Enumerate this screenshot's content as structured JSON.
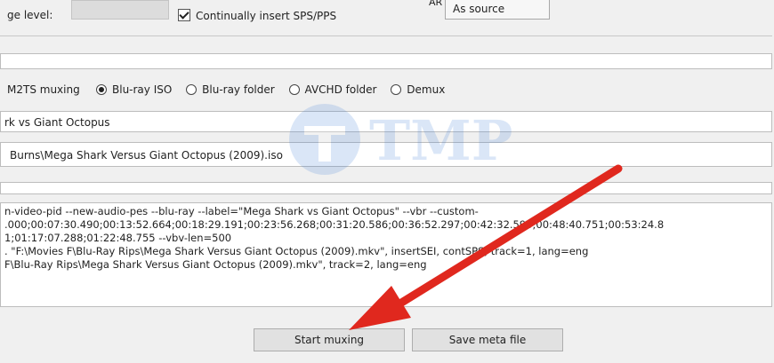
{
  "top": {
    "level_label": "ge level:",
    "sps_checkbox_label": "Continually insert SPS/PPS",
    "sps_checked": true,
    "ar_label": "AR",
    "ar_value": "As source"
  },
  "mux": {
    "label": "M2TS muxing",
    "options": [
      {
        "label": "Blu-ray ISO",
        "selected": true
      },
      {
        "label": "Blu-ray folder",
        "selected": false
      },
      {
        "label": "AVCHD folder",
        "selected": false
      },
      {
        "label": "Demux",
        "selected": false
      }
    ]
  },
  "disc_label_value": "rk vs Giant Octopus",
  "output_path": "Burns\\Mega Shark Versus Giant Octopus (2009).iso",
  "meta_lines": [
    "n-video-pid --new-audio-pes --blu-ray --label=\"Mega Shark vs Giant Octopus\" --vbr  --custom-",
    ".000;00:07:30.490;00:13:52.664;00:18:29.191;00:23:56.268;00:31:20.586;00:36:52.297;00:42:32.590;00:48:40.751;00:53:24.8",
    "1;01:17:07.288;01:22:48.755 --vbv-len=500",
    ". \"F:\\Movies F\\Blu-Ray Rips\\Mega Shark Versus Giant Octopus (2009).mkv\", insertSEI, contSPS, track=1, lang=eng",
    "F\\Blu-Ray Rips\\Mega Shark Versus Giant Octopus (2009).mkv\", track=2, lang=eng"
  ],
  "buttons": {
    "start": "Start muxing",
    "save_meta": "Save meta file"
  },
  "colors": {
    "arrow": "#e0281e",
    "watermark": "#3a7bd5"
  }
}
